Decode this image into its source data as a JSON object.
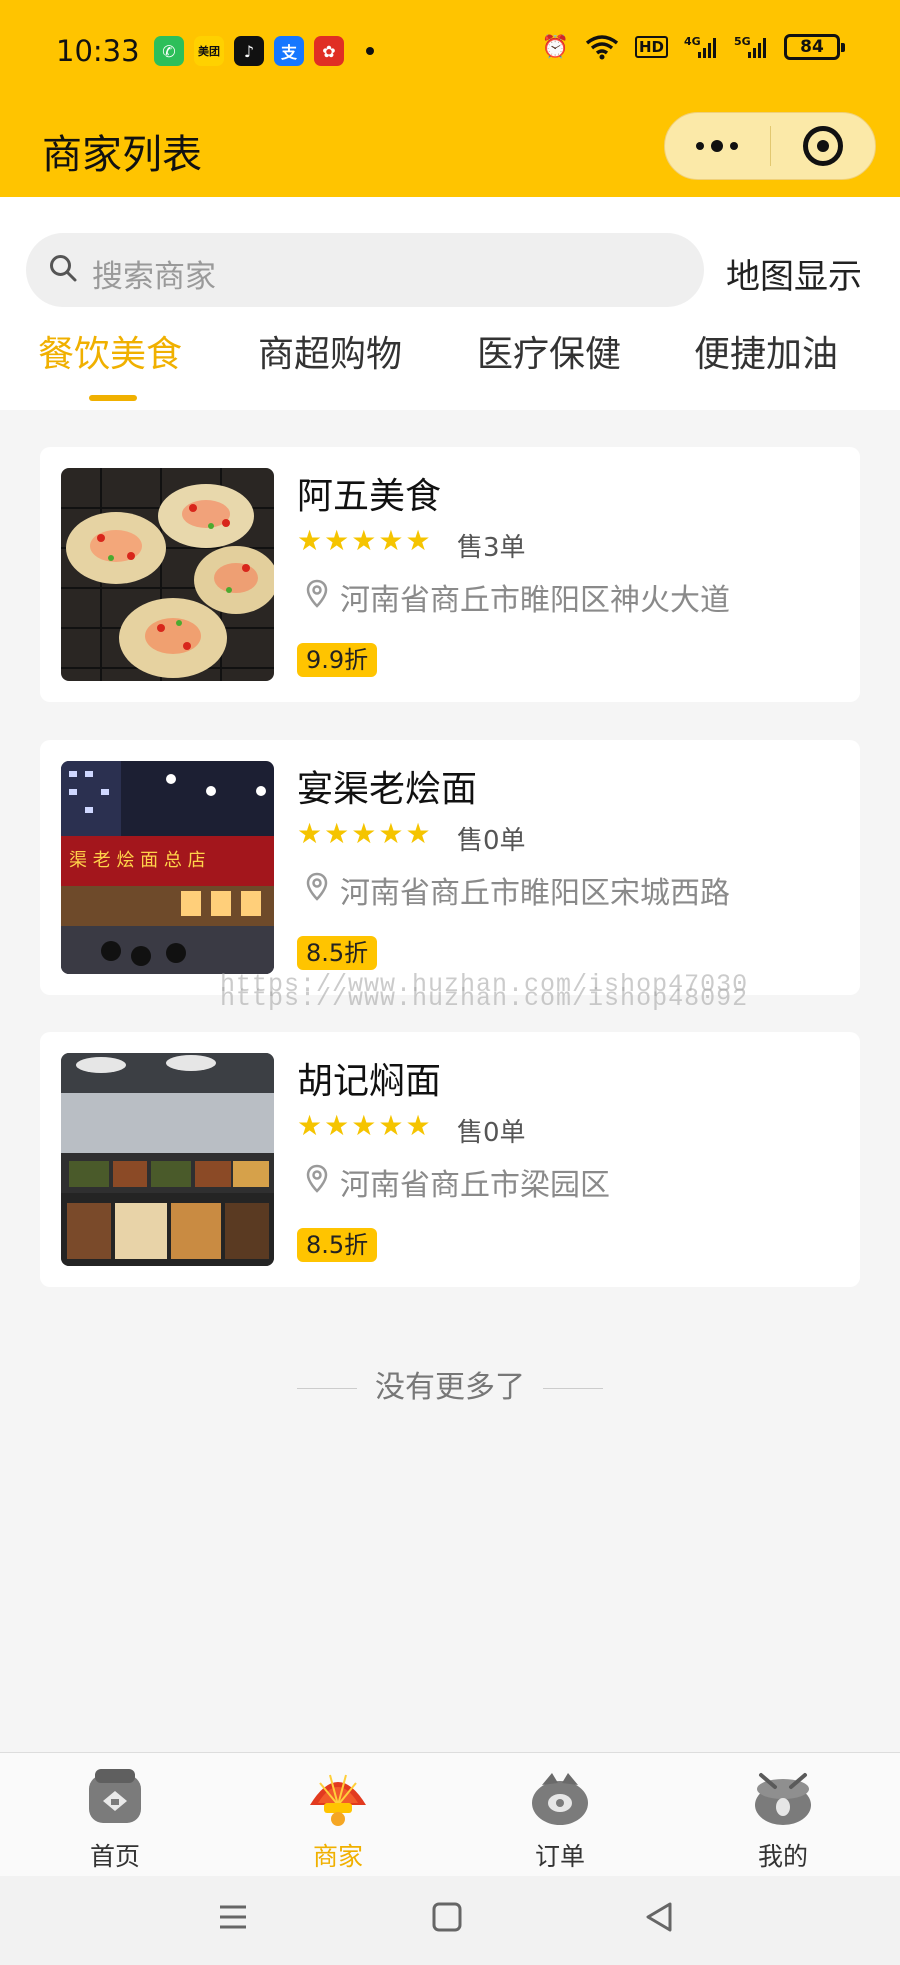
{
  "status_bar": {
    "time": "10:33",
    "battery": "84",
    "apps": [
      "phone-icon",
      "meituan-icon",
      "tiktok-icon",
      "alipay-icon",
      "pinduoduo-icon"
    ]
  },
  "nav": {
    "title": "商家列表"
  },
  "search": {
    "placeholder": "搜索商家",
    "map_label": "地图显示"
  },
  "tabs": [
    {
      "label": "餐饮美食",
      "active": true
    },
    {
      "label": "商超购物",
      "active": false
    },
    {
      "label": "医疗保健",
      "active": false
    },
    {
      "label": "便捷加油",
      "active": false
    }
  ],
  "merchants": [
    {
      "name": "阿五美食",
      "rating": 5,
      "sold": "售3单",
      "address": "河南省商丘市睢阳区神火大道",
      "discount": "9.9折"
    },
    {
      "name": "宴渠老烩面",
      "rating": 5,
      "sold": "售0单",
      "address": "河南省商丘市睢阳区宋城西路",
      "discount": "8.5折"
    },
    {
      "name": "胡记焖面",
      "rating": 5,
      "sold": "售0单",
      "address": "河南省商丘市梁园区",
      "discount": "8.5折"
    }
  ],
  "no_more": "没有更多了",
  "watermark": {
    "line1": "https://www.huzhan.com/ishop47030",
    "line2": "https://www.huzhan.com/ishop48092"
  },
  "tabbar": [
    {
      "label": "首页",
      "icon": "home-icon",
      "active": false
    },
    {
      "label": "商家",
      "icon": "merchant-icon",
      "active": true
    },
    {
      "label": "订单",
      "icon": "order-icon",
      "active": false
    },
    {
      "label": "我的",
      "icon": "profile-icon",
      "active": false
    }
  ],
  "colors": {
    "brand": "#ffc400",
    "accent_text": "#f0b000",
    "star": "#f5c400"
  }
}
